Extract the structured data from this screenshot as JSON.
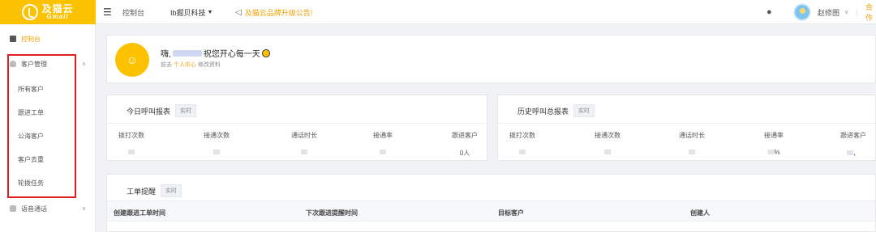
{
  "brand": {
    "cn": "及猫云",
    "en": "Gmall"
  },
  "topbar": {
    "menu_icon": "menu-fold-icon",
    "crumb": "控制台",
    "company": "Ib掘贝科技",
    "notice": "及猫云品牌升级公告!",
    "user": "赵修图",
    "partner": "合作"
  },
  "sidebar": {
    "dashboard": "控制台",
    "customer_group": "客户管理",
    "items": [
      "所有客户",
      "跟进工单",
      "公海客户",
      "客户去重",
      "轮拨任务"
    ],
    "voice": "语音通话"
  },
  "welcome": {
    "greeting_prefix": "嗨,",
    "greeting_suffix": "祝您开心每一天",
    "goto": "前去",
    "link": "个人中心",
    "tail": "修改资料"
  },
  "today_report": {
    "title": "今日呼叫报表",
    "tag": "实时",
    "columns": [
      "拨打次数",
      "接通次数",
      "通话时长",
      "接通率",
      "跟进客户"
    ],
    "values": [
      "",
      "",
      "",
      "",
      "0人"
    ]
  },
  "history_report": {
    "title": "历史呼叫总报表",
    "tag": "实时",
    "columns": [
      "拨打次数",
      "接通次数",
      "通话时长",
      "接通率",
      "跟进客户"
    ],
    "values": [
      "",
      "",
      "",
      "%",
      "、"
    ]
  },
  "orders": {
    "title": "工单提醒",
    "tag": "实时",
    "headers": [
      "创建跟进工单时间",
      "下次跟进提醒时间",
      "目标客户",
      "创建人"
    ]
  },
  "colors": {
    "brand": "#fcc200",
    "accent": "#f0a000",
    "highlight": "#e02020"
  }
}
